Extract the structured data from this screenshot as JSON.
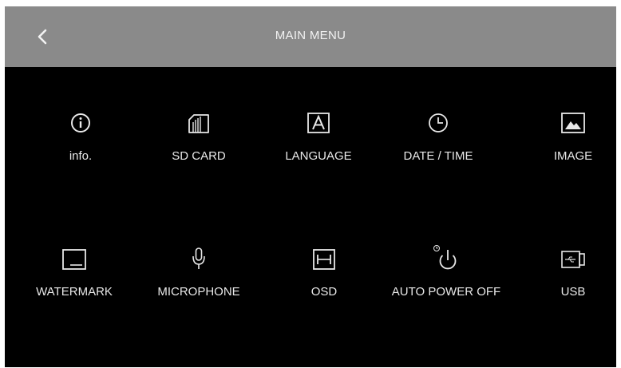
{
  "header": {
    "title": "MAIN MENU",
    "back_icon": "chevron-left-icon"
  },
  "colors": {
    "header_bg": "#8a8a8a",
    "screen_bg": "#000000",
    "text": "#e8e8e8"
  },
  "menu": {
    "items": [
      {
        "label": "info.",
        "icon": "info-icon"
      },
      {
        "label": "SD CARD",
        "icon": "sd-card-icon"
      },
      {
        "label": "LANGUAGE",
        "icon": "language-icon"
      },
      {
        "label": "DATE / TIME",
        "icon": "clock-icon"
      },
      {
        "label": "IMAGE",
        "icon": "image-icon"
      },
      {
        "label": "WATERMARK",
        "icon": "watermark-icon"
      },
      {
        "label": "MICROPHONE",
        "icon": "microphone-icon"
      },
      {
        "label": "OSD",
        "icon": "osd-icon"
      },
      {
        "label": "AUTO POWER OFF",
        "icon": "auto-power-off-icon"
      },
      {
        "label": "USB",
        "icon": "usb-icon"
      }
    ]
  }
}
